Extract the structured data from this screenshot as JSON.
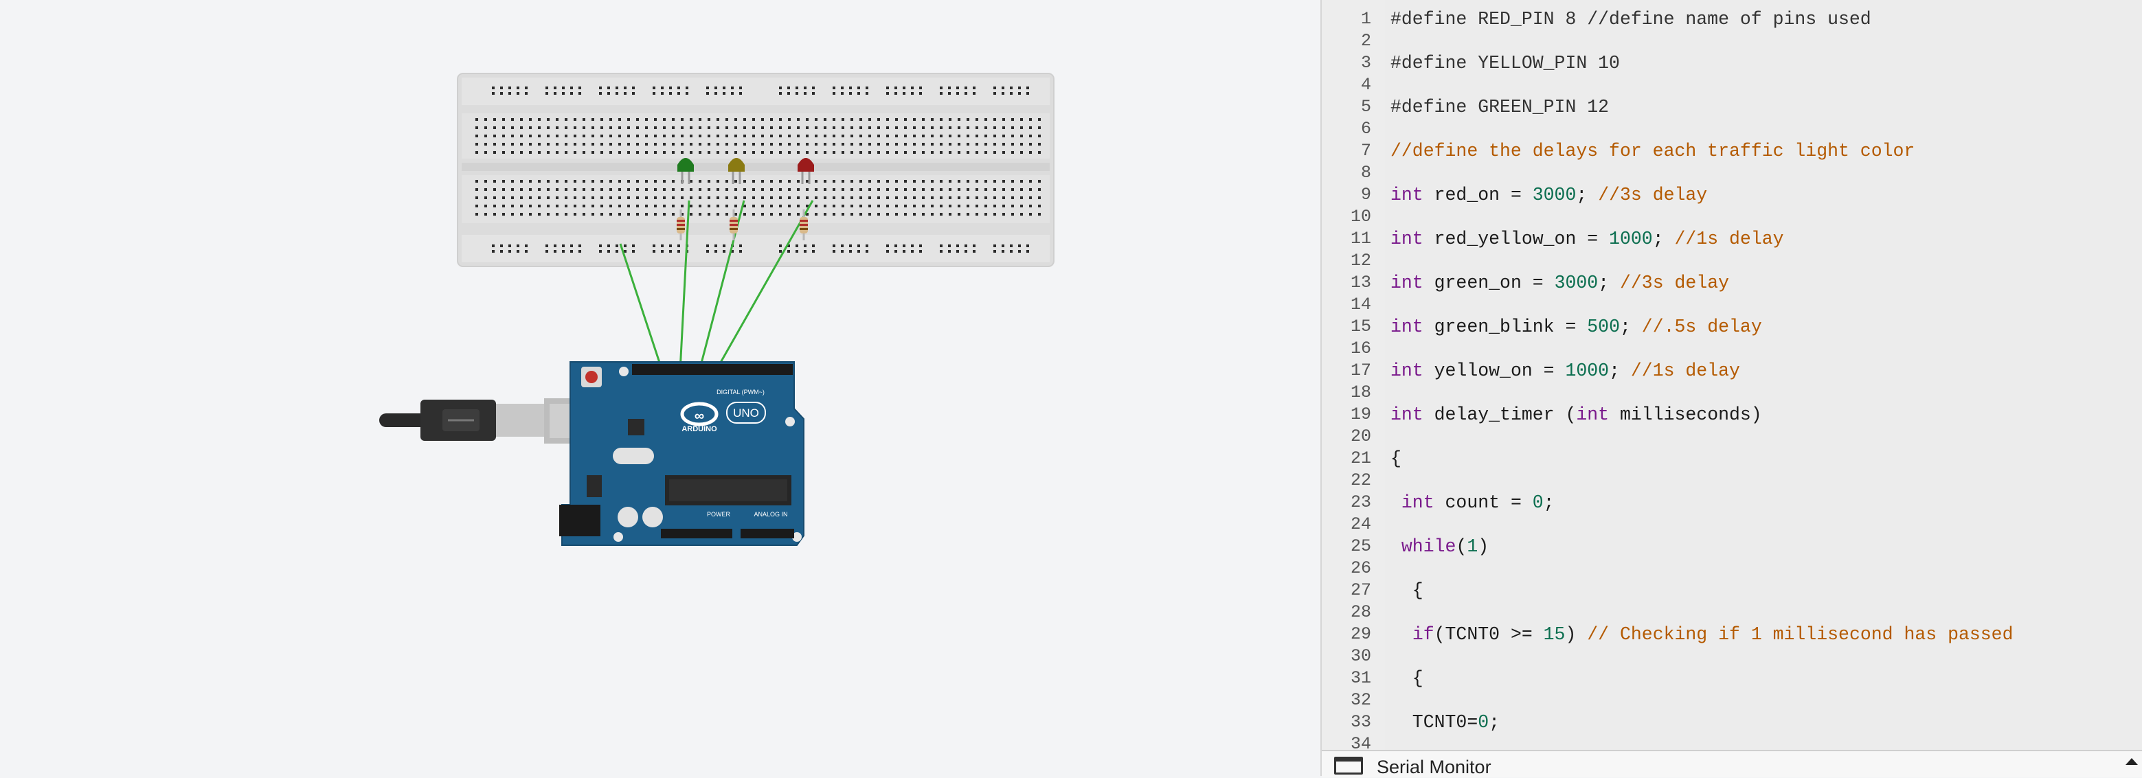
{
  "board": {
    "logo_text": "ARDUINO",
    "model": "UNO",
    "digital_label": "DIGITAL (PWM~)",
    "power_label": "POWER",
    "analog_label": "ANALOG IN"
  },
  "leds": [
    {
      "name": "green",
      "color": "#1f7a1f"
    },
    {
      "name": "yellow",
      "color": "#8a7a12"
    },
    {
      "name": "red",
      "color": "#9b1b1b"
    }
  ],
  "editor": {
    "lines": [
      {
        "n": "1",
        "tokens": [
          {
            "t": "#define RED_PIN 8 //define name of pins used",
            "c": "pp"
          }
        ]
      },
      {
        "n": "2",
        "tokens": []
      },
      {
        "n": "3",
        "tokens": [
          {
            "t": "#define YELLOW_PIN 10",
            "c": "pp"
          }
        ]
      },
      {
        "n": "4",
        "tokens": []
      },
      {
        "n": "5",
        "tokens": [
          {
            "t": "#define GREEN_PIN 12",
            "c": "pp"
          }
        ]
      },
      {
        "n": "6",
        "tokens": []
      },
      {
        "n": "7",
        "tokens": [
          {
            "t": "//define the delays for each traffic light color",
            "c": "cm"
          }
        ]
      },
      {
        "n": "8",
        "tokens": []
      },
      {
        "n": "9",
        "tokens": [
          {
            "t": "int",
            "c": "kw"
          },
          {
            "t": " red_on = ",
            "c": ""
          },
          {
            "t": "3000",
            "c": "num"
          },
          {
            "t": "; ",
            "c": ""
          },
          {
            "t": "//3s delay",
            "c": "cm"
          }
        ]
      },
      {
        "n": "10",
        "tokens": []
      },
      {
        "n": "11",
        "tokens": [
          {
            "t": "int",
            "c": "kw"
          },
          {
            "t": " red_yellow_on = ",
            "c": ""
          },
          {
            "t": "1000",
            "c": "num"
          },
          {
            "t": "; ",
            "c": ""
          },
          {
            "t": "//1s delay",
            "c": "cm"
          }
        ]
      },
      {
        "n": "12",
        "tokens": []
      },
      {
        "n": "13",
        "tokens": [
          {
            "t": "int",
            "c": "kw"
          },
          {
            "t": " green_on = ",
            "c": ""
          },
          {
            "t": "3000",
            "c": "num"
          },
          {
            "t": "; ",
            "c": ""
          },
          {
            "t": "//3s delay",
            "c": "cm"
          }
        ]
      },
      {
        "n": "14",
        "tokens": []
      },
      {
        "n": "15",
        "tokens": [
          {
            "t": "int",
            "c": "kw"
          },
          {
            "t": " green_blink = ",
            "c": ""
          },
          {
            "t": "500",
            "c": "num"
          },
          {
            "t": "; ",
            "c": ""
          },
          {
            "t": "//.5s delay",
            "c": "cm"
          }
        ]
      },
      {
        "n": "16",
        "tokens": []
      },
      {
        "n": "17",
        "tokens": [
          {
            "t": "int",
            "c": "kw"
          },
          {
            "t": " yellow_on = ",
            "c": ""
          },
          {
            "t": "1000",
            "c": "num"
          },
          {
            "t": "; ",
            "c": ""
          },
          {
            "t": "//1s delay",
            "c": "cm"
          }
        ]
      },
      {
        "n": "18",
        "tokens": []
      },
      {
        "n": "19",
        "tokens": [
          {
            "t": "int",
            "c": "kw"
          },
          {
            "t": " delay_timer (",
            "c": ""
          },
          {
            "t": "int",
            "c": "kw"
          },
          {
            "t": " milliseconds)",
            "c": ""
          }
        ]
      },
      {
        "n": "20",
        "tokens": []
      },
      {
        "n": "21",
        "tokens": [
          {
            "t": "{",
            "c": ""
          }
        ]
      },
      {
        "n": "22",
        "tokens": []
      },
      {
        "n": "23",
        "tokens": [
          {
            "t": " ",
            "c": ""
          },
          {
            "t": "int",
            "c": "kw"
          },
          {
            "t": " count = ",
            "c": ""
          },
          {
            "t": "0",
            "c": "num"
          },
          {
            "t": ";",
            "c": ""
          }
        ]
      },
      {
        "n": "24",
        "tokens": []
      },
      {
        "n": "25",
        "tokens": [
          {
            "t": " ",
            "c": ""
          },
          {
            "t": "while",
            "c": "kw"
          },
          {
            "t": "(",
            "c": ""
          },
          {
            "t": "1",
            "c": "num"
          },
          {
            "t": ")",
            "c": ""
          }
        ]
      },
      {
        "n": "26",
        "tokens": []
      },
      {
        "n": "27",
        "tokens": [
          {
            "t": "  {",
            "c": ""
          }
        ]
      },
      {
        "n": "28",
        "tokens": []
      },
      {
        "n": "29",
        "tokens": [
          {
            "t": "  ",
            "c": ""
          },
          {
            "t": "if",
            "c": "kw"
          },
          {
            "t": "(TCNT0 >= ",
            "c": ""
          },
          {
            "t": "15",
            "c": "num"
          },
          {
            "t": ") ",
            "c": ""
          },
          {
            "t": "// Checking if 1 millisecond has passed",
            "c": "cm"
          }
        ]
      },
      {
        "n": "30",
        "tokens": []
      },
      {
        "n": "31",
        "tokens": [
          {
            "t": "  {",
            "c": ""
          }
        ]
      },
      {
        "n": "32",
        "tokens": []
      },
      {
        "n": "33",
        "tokens": [
          {
            "t": "  TCNT0=",
            "c": ""
          },
          {
            "t": "0",
            "c": "num"
          },
          {
            "t": ";",
            "c": ""
          }
        ]
      },
      {
        "n": "34",
        "tokens": []
      }
    ]
  },
  "serial_monitor": {
    "label": "Serial Monitor"
  }
}
